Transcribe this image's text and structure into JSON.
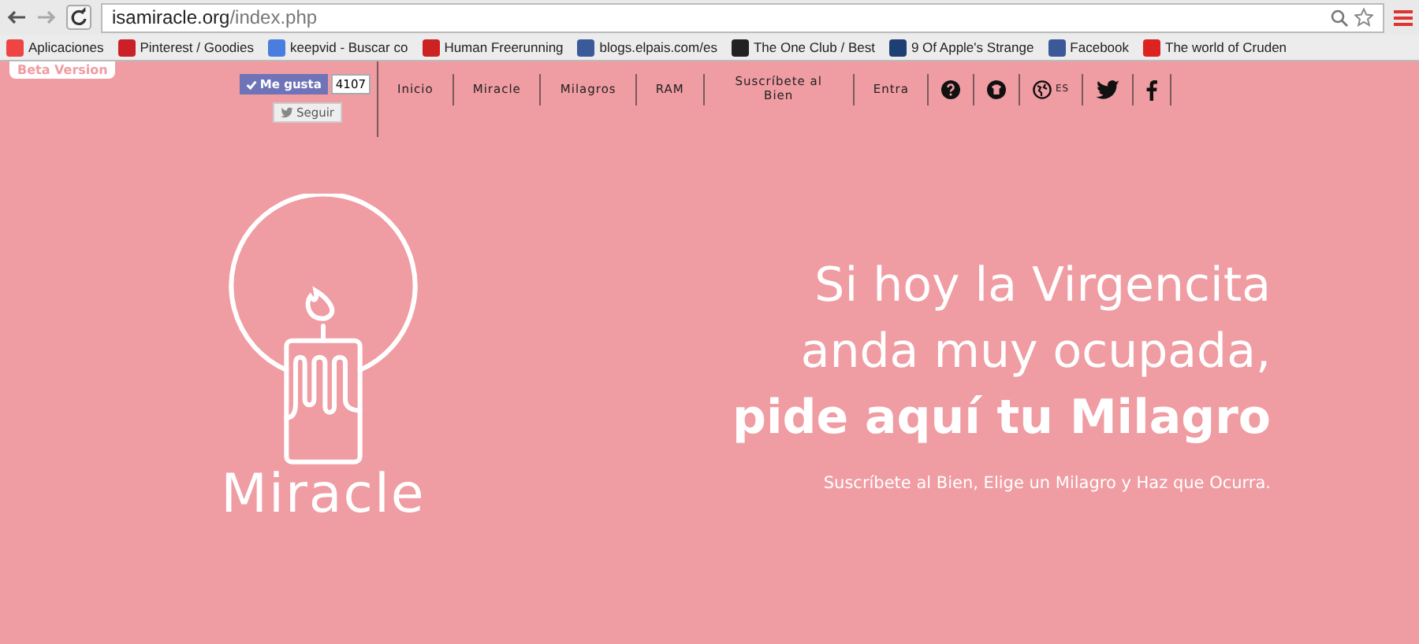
{
  "browser": {
    "url_host": "isamiracle.org",
    "url_path": "/index.php",
    "bookmarks": [
      {
        "kind": "apps",
        "label": "Aplicaciones"
      },
      {
        "kind": "pinterest",
        "label": "Pinterest / Goodies"
      },
      {
        "kind": "google",
        "label": "keepvid - Buscar co"
      },
      {
        "kind": "flash",
        "label": "Human Freerunning"
      },
      {
        "kind": "elpais",
        "label": "blogs.elpais.com/es"
      },
      {
        "kind": "oneclub",
        "label": "The One Club / Best"
      },
      {
        "kind": "bi",
        "label": "9 Of Apple's Strange"
      },
      {
        "kind": "facebook",
        "label": "Facebook"
      },
      {
        "kind": "youtube",
        "label": "The world of Cruden"
      }
    ]
  },
  "badge": "Beta Version",
  "social": {
    "like": "Me gusta",
    "count": "4107",
    "follow": "Seguir"
  },
  "nav": [
    {
      "kind": "text",
      "label": "Inicio"
    },
    {
      "kind": "text",
      "label": "Miracle"
    },
    {
      "kind": "text",
      "label": "Milagros"
    },
    {
      "kind": "text",
      "label": "RAM"
    },
    {
      "kind": "text",
      "label": "Suscríbete al Bien"
    },
    {
      "kind": "text",
      "label": "Entra"
    },
    {
      "kind": "help"
    },
    {
      "kind": "shirt"
    },
    {
      "kind": "globe",
      "label": "ES"
    },
    {
      "kind": "twitter"
    },
    {
      "kind": "facebook"
    }
  ],
  "logo": "Miracle",
  "hero": {
    "lines": [
      "Si hoy la Virgencita",
      "anda muy ocupada,"
    ],
    "strong": "pide aquí tu Milagro",
    "subtitle": "Suscríbete al Bien, Elige un Milagro y Haz que Ocurra."
  }
}
